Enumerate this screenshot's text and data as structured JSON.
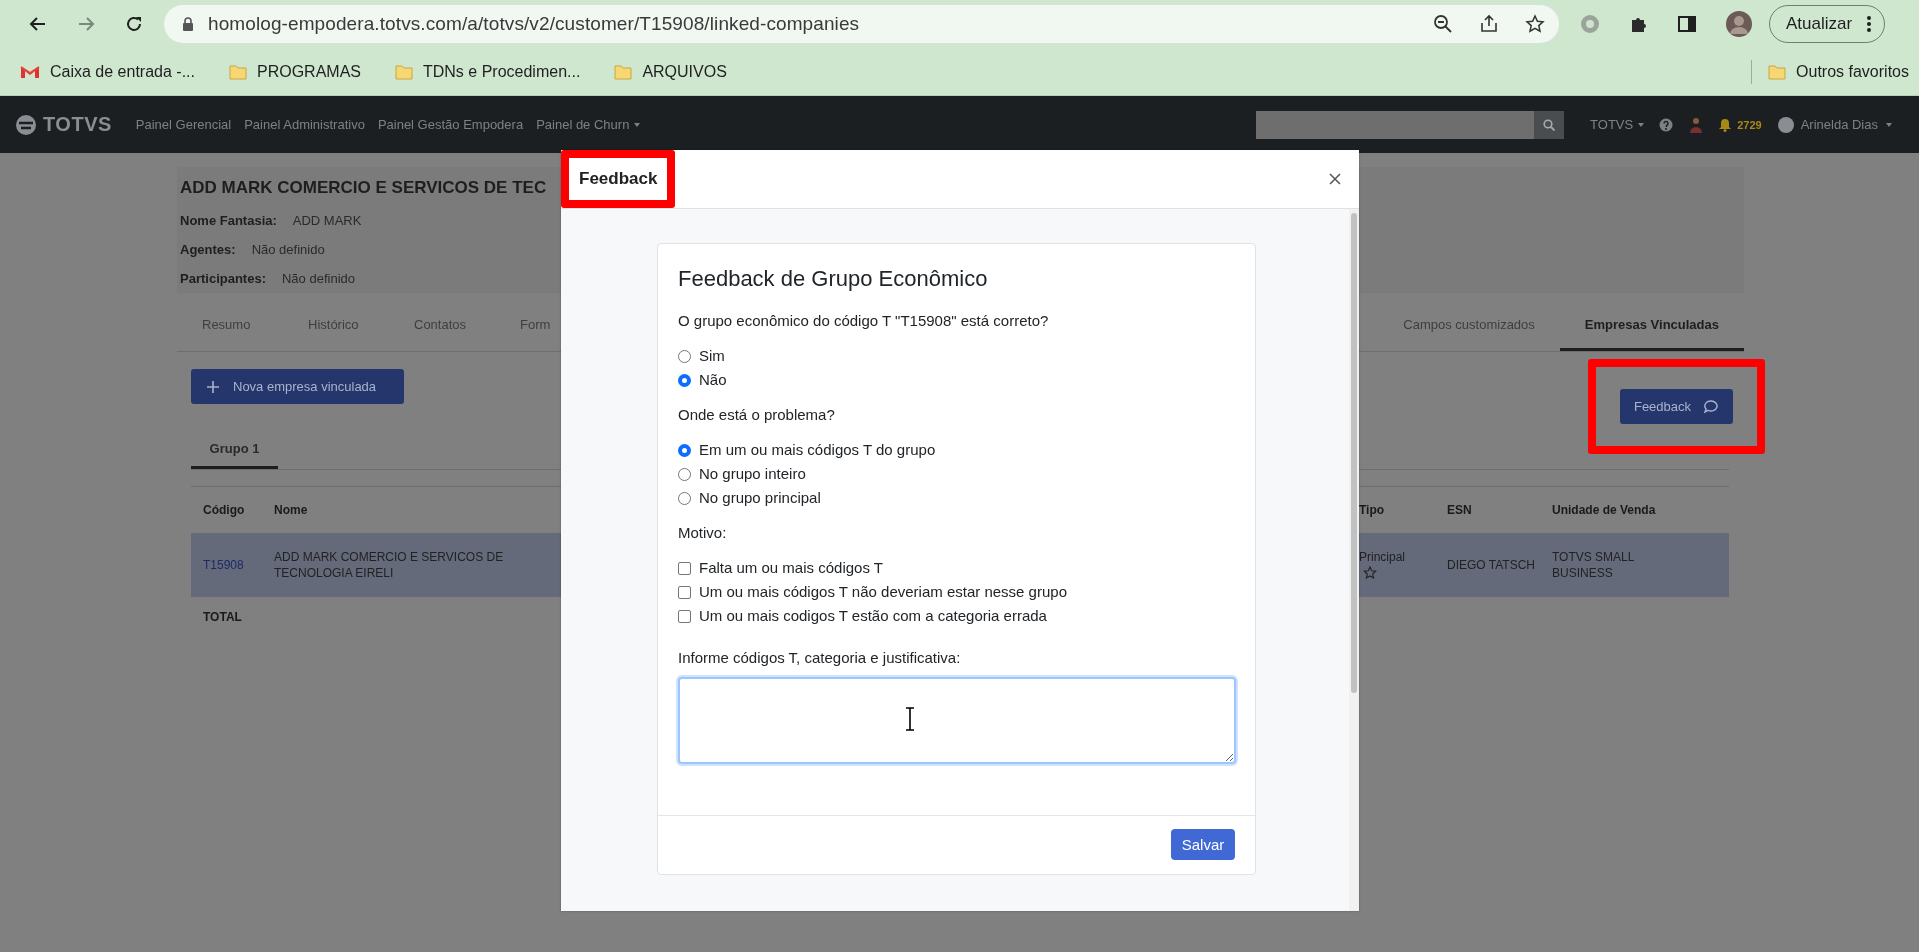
{
  "browser": {
    "url": "homolog-empodera.totvs.com/a/totvs/v2/customer/T15908/linked-companies",
    "update_button": "Atualizar",
    "bookmarks": [
      {
        "label": "Caixa de entrada -...",
        "kind": "mail"
      },
      {
        "label": "PROGRAMAS",
        "kind": "folder"
      },
      {
        "label": "TDNs e Procedimen...",
        "kind": "folder"
      },
      {
        "label": "ARQUIVOS",
        "kind": "folder"
      }
    ],
    "other_bookmarks": "Outros favoritos"
  },
  "nav": {
    "logo": "TOTVS",
    "links": [
      {
        "label": "Painel Gerencial",
        "dropdown": false
      },
      {
        "label": "Painel Administrativo",
        "dropdown": false
      },
      {
        "label": "Painel Gestão Empodera",
        "dropdown": false
      },
      {
        "label": "Painel de Churn",
        "dropdown": true
      }
    ],
    "company_menu": "TOTVS",
    "notification_count": "2729",
    "user": "Arinelda Dias"
  },
  "company": {
    "title": "ADD MARK COMERCIO E SERVICOS DE TEC",
    "fields": [
      {
        "label": "Nome Fantasia:",
        "value": "ADD MARK"
      },
      {
        "label": "Agentes:",
        "value": "Não definido"
      },
      {
        "label": "Participantes:",
        "value": "Não definido"
      }
    ]
  },
  "tab_groups": [
    {
      "tabs": [
        {
          "label": "Resumo",
          "selected": false
        },
        {
          "label": "Histórico",
          "selected": false
        },
        {
          "label": "Contatos",
          "selected": false
        },
        {
          "label": "Form",
          "selected": false
        }
      ]
    },
    {
      "tabs": [
        {
          "label": "Campos customizados",
          "selected": false
        },
        {
          "label": "Empresas Vinculadas",
          "selected": true
        }
      ]
    }
  ],
  "new_button": "Nova empresa vinculada",
  "feedback_button": {
    "label": "Feedback",
    "highlighted": true
  },
  "group_tabs": [
    {
      "label": "Grupo 1",
      "selected": true
    }
  ],
  "table": {
    "columns": [
      "Código",
      "Nome",
      "Tipo",
      "ESN",
      "Unidade de Venda"
    ],
    "rows": [
      {
        "code": "T15908",
        "name": "ADD MARK COMERCIO E SERVICOS DE TECNOLOGIA EIRELI",
        "type": "Principal",
        "starred": false,
        "esn": "DIEGO TATSCH",
        "unit": "TOTVS SMALL BUSINESS",
        "selected": true
      }
    ],
    "total": "TOTAL"
  },
  "modal": {
    "title": "Feedback",
    "title_highlighted": true,
    "heading": "Feedback de Grupo Econômico",
    "question": "O grupo econômico do código T \"T15908\" está correto?",
    "answers": [
      {
        "label": "Sim",
        "selected": false
      },
      {
        "label": "Não",
        "selected": true
      }
    ],
    "problem_label": "Onde está o problema?",
    "problems": [
      {
        "label": "Em um ou mais códigos T do grupo",
        "selected": true
      },
      {
        "label": "No grupo inteiro",
        "selected": false
      },
      {
        "label": "No grupo principal",
        "selected": false
      }
    ],
    "reason_label": "Motivo:",
    "reasons": [
      {
        "label": "Falta um ou mais códigos T",
        "checked": false
      },
      {
        "label": "Um ou mais códigos T não deveriam estar nesse grupo",
        "checked": false
      },
      {
        "label": "Um ou mais codigos T estão com a categoria errada",
        "checked": false
      }
    ],
    "details_label": "Informe códigos T, categoria e justificativa:",
    "save_button": "Salvar"
  }
}
